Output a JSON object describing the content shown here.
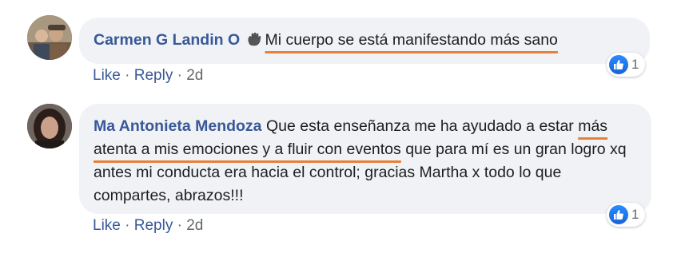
{
  "comments": [
    {
      "author": "Carmen G Landin O",
      "badge_icon": "waving-hand-icon",
      "text_highlighted": "Mi cuerpo se está manifestando más sano",
      "actions": {
        "like": "Like",
        "reply": "Reply",
        "sep": "·",
        "age": "2d"
      },
      "reaction": {
        "icon": "thumbs-up-icon",
        "count": "1"
      }
    },
    {
      "author": "Ma Antonieta Mendoza",
      "text_before": " Que esta enseñanza me ha ayudado a estar ",
      "text_highlighted": "más atenta a mis emociones y a fluir con eventos",
      "text_after": " que para mí es un gran logro xq antes mi conducta era hacia el control; gracias Martha x todo lo que compartes, abrazos!!!",
      "actions": {
        "like": "Like",
        "reply": "Reply",
        "sep": "·",
        "age": "2d"
      },
      "reaction": {
        "icon": "thumbs-up-icon",
        "count": "1"
      }
    }
  ],
  "colors": {
    "author": "#385898",
    "bubble": "#f0f2f5",
    "highlight": "#e8803a",
    "like": "#1877f2"
  }
}
